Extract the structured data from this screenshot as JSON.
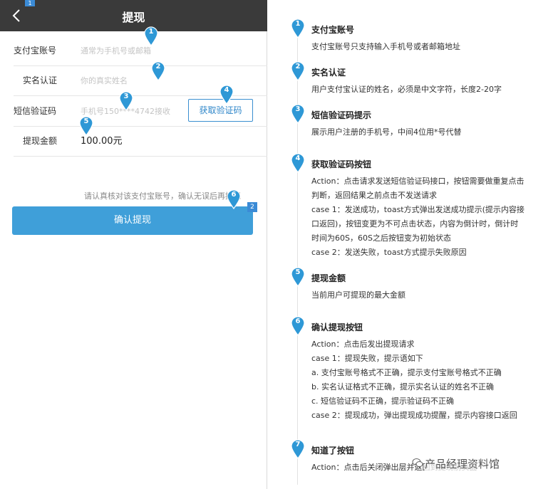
{
  "phone": {
    "title": "提现",
    "page_tag": "1",
    "rows": [
      {
        "label": "支付宝账号",
        "placeholder": "通常为手机号或邮箱"
      },
      {
        "label": "实名认证",
        "placeholder": "你的真实姓名"
      },
      {
        "label": "短信验证码",
        "placeholder": "手机号150****4742接收"
      },
      {
        "label": "提现金额",
        "value": "100.00元"
      }
    ],
    "code_button": "获取验证码",
    "notice": "请认真核对该支付宝账号，确认无误后再提现",
    "confirm_button": "确认提现",
    "confirm_tag": "2",
    "pins": [
      "1",
      "2",
      "3",
      "4",
      "5",
      "6"
    ]
  },
  "annotations": [
    {
      "num": "1",
      "title": "支付宝账号",
      "lines": [
        "支付宝账号只支持输入手机号或者邮箱地址"
      ]
    },
    {
      "num": "2",
      "title": "实名认证",
      "lines": [
        "用户支付宝认证的姓名，必须是中文字符，长度2-20字"
      ]
    },
    {
      "num": "3",
      "title": "短信验证码提示",
      "lines": [
        "展示用户注册的手机号，中间4位用*号代替"
      ]
    },
    {
      "num": "4",
      "title": "获取验证码按钮",
      "lines": [
        "Action：点击请求发送短信验证码接口，按钮需要做重复点击",
        "判断，返回结果之前点击不发送请求",
        "case 1：发送成功，toast方式弹出发送成功提示(提示内容接",
        "口返回)，按钮变更为不可点击状态，内容为倒计时，倒计时",
        "时间为60S，60S之后按钮变为初始状态",
        "case 2：发送失败，toast方式提示失败原因"
      ]
    },
    {
      "num": "5",
      "title": "提现金额",
      "lines": [
        "当前用户可提现的最大金额"
      ]
    },
    {
      "num": "6",
      "title": "确认提现按钮",
      "lines": [
        "Action：点击后发出提现请求",
        "case 1：提现失败，提示语如下",
        "a. 支付宝账号格式不正确，提示支付宝账号格式不正确",
        "b. 实名认证格式不正确，提示实名认证的姓名不正确",
        "c. 短信验证码不正确，提示验证码不正确",
        "case 2：提现成功，弹出提现成功提醒，提示内容接口返回"
      ]
    },
    {
      "num": "7",
      "title": "知道了按钮",
      "lines": [
        "Action：点击后关闭弹出层并返回到提现前页面"
      ]
    }
  ],
  "watermark": "产品经理资料馆",
  "colors": {
    "nav_bg": "#3a3a3a",
    "accent": "#3f9fd9",
    "pin": "#2e98d6"
  }
}
